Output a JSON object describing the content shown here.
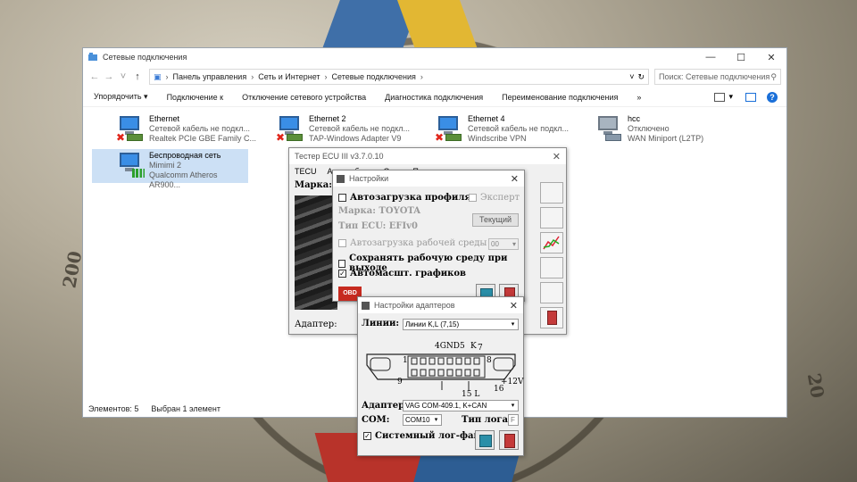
{
  "explorer": {
    "title": "Сетевые подключения",
    "breadcrumb": [
      "Панель управления",
      "Сеть и Интернет",
      "Сетевые подключения"
    ],
    "search_placeholder": "Поиск: Сетевые подключения",
    "commands": [
      "Упорядочить ▾",
      "Подключение к",
      "Отключение сетевого устройства",
      "Диагностика подключения",
      "Переименование подключения",
      "»"
    ],
    "connections": [
      {
        "name": "Ethernet",
        "status": "Сетевой кабель не подкл...",
        "adapter": "Realtek PCIe GBE Family C...",
        "state": "disconnected"
      },
      {
        "name": "Ethernet 2",
        "status": "Сетевой кабель не подкл...",
        "adapter": "TAP-Windows Adapter V9",
        "state": "disconnected"
      },
      {
        "name": "Ethernet 4",
        "status": "Сетевой кабель не подкл...",
        "adapter": "Windscribe VPN",
        "state": "disconnected"
      },
      {
        "name": "hcc",
        "status": "Отключено",
        "adapter": "WAN Miniport (L2TP)",
        "state": "disabled"
      },
      {
        "name": "Беспроводная сеть",
        "status": "Mimimi 2",
        "adapter": "Qualcomm Atheros AR900...",
        "state": "wifi"
      }
    ],
    "status_count": "Элементов: 5",
    "status_selected": "Выбран 1 элемент"
  },
  "ecu": {
    "title": "Тестер ECU III v3.7.0.10",
    "menu": [
      "TECU",
      "Автомобиль",
      "Окна",
      "Помощь"
    ],
    "marka_label": "Марка:",
    "adapter_label": "Адаптер:"
  },
  "settings": {
    "title": "Настройки",
    "autoload_profile": "Автозагрузка профиля",
    "expert": "Эксперт",
    "marka": "Марка: TOYOTA",
    "ecu_type": "Тип ECU: EFIv0",
    "current_button": "Текущий",
    "autoload_env": "Автозагрузка рабочей среды №",
    "env_number": "00",
    "save_env": "Сохранять рабочую среду при выходе",
    "autoscale": "Автомасшт. графиков",
    "obd_label": "OBD"
  },
  "adapters": {
    "title": "Настройки адаптеров",
    "lines_label": "Линии:",
    "lines_value": "Линии K,L (7,15)",
    "pins_top": "4GND5",
    "pin_k": "K",
    "pin_7": "7",
    "pin_1": "1",
    "pin_8": "8",
    "pin_9": "9",
    "pin_16": "16",
    "pin_15l": "15 L",
    "plus12v": "+12V",
    "adapter_label": "Адаптер:",
    "adapter_value": "VAG COM-409.1, K+CAN",
    "com_label": "COM:",
    "com_value": "COM10",
    "log_type_label": "Тип лога:",
    "log_type_value": "F",
    "system_log": "Системный лог-файл"
  },
  "wallpaper_numbers": [
    "200",
    "20"
  ]
}
